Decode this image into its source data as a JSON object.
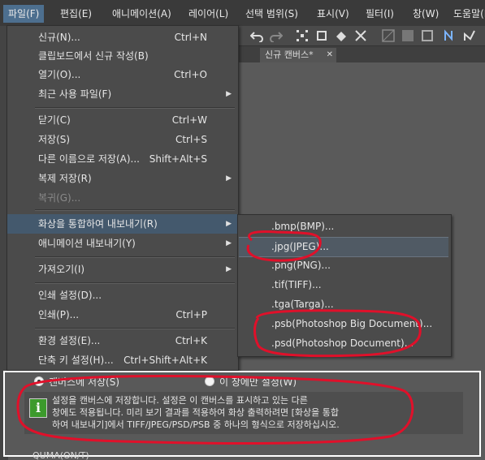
{
  "menubar": {
    "items": [
      {
        "label": "파일(F)"
      },
      {
        "label": "편집(E)"
      },
      {
        "label": "애니메이션(A)"
      },
      {
        "label": "레이어(L)"
      },
      {
        "label": "선택 범위(S)"
      },
      {
        "label": "표시(V)"
      },
      {
        "label": "필터(I)"
      },
      {
        "label": "창(W)"
      },
      {
        "label": "도움말(H)"
      }
    ]
  },
  "document_tab": {
    "label": "신규 캔버스*",
    "close": "✕"
  },
  "file_menu": {
    "items": [
      {
        "label": "신규(N)...",
        "shortcut": "Ctrl+N"
      },
      {
        "label": "클립보드에서 신규 작성(B)",
        "shortcut": ""
      },
      {
        "label": "열기(O)...",
        "shortcut": "Ctrl+O"
      },
      {
        "label": "최근 사용 파일(F)",
        "shortcut": "",
        "arrow": "▶"
      },
      {
        "label": "닫기(C)",
        "shortcut": "Ctrl+W"
      },
      {
        "label": "저장(S)",
        "shortcut": "Ctrl+S"
      },
      {
        "label": "다른 이름으로 저장(A)...",
        "shortcut": "Shift+Alt+S"
      },
      {
        "label": "복제 저장(R)",
        "shortcut": "",
        "arrow": "▶"
      },
      {
        "label": "복귀(G)...",
        "shortcut": "",
        "disabled": true
      },
      {
        "label": "화상을 통합하여 내보내기(R)",
        "shortcut": "",
        "arrow": "▶",
        "highlighted": true
      },
      {
        "label": "애니메이션 내보내기(Y)",
        "shortcut": "",
        "arrow": "▶"
      },
      {
        "label": "가져오기(I)",
        "shortcut": "",
        "arrow": "▶"
      },
      {
        "label": "인쇄 설정(D)...",
        "shortcut": ""
      },
      {
        "label": "인쇄(P)...",
        "shortcut": "Ctrl+P"
      },
      {
        "label": "환경 설정(E)...",
        "shortcut": "Ctrl+K"
      },
      {
        "label": "단축 키 설정(H)...",
        "shortcut": "Ctrl+Shift+Alt+K"
      }
    ]
  },
  "export_submenu": {
    "items": [
      {
        "label": ".bmp(BMP)..."
      },
      {
        "label": ".jpg(JPEG)...",
        "highlighted": true
      },
      {
        "label": ".png(PNG)..."
      },
      {
        "label": ".tif(TIFF)..."
      },
      {
        "label": ".tga(Targa)..."
      },
      {
        "label": ".psb(Photoshop Big Document)..."
      },
      {
        "label": ".psd(Photoshop Document)..."
      }
    ]
  },
  "dialog": {
    "radio_canvas": "캔버스에 저장(S)",
    "radio_window": "이 창에만 설정(W)",
    "info_line1": "설정을 캔버스에 저장합니다. 설정은 이 캔버스를 표시하고 있는 다른",
    "info_line2": "창에도 적용됩니다. 미리 보기 결과를 적용하여 화상 출력하려면 [화상을 통합",
    "info_line3": "하여 내보내기]에서 TIFF/JPEG/PSD/PSB 중 하나의 형식으로 저장하십시오.",
    "cut_text": "QUMA(ON/T)"
  },
  "colors": {
    "menu_bg": "#4b4b4b",
    "highlight": "#44596d",
    "annotation": "#e0102a",
    "info_icon": "#3c9a2c"
  },
  "icons": [
    "undo-icon",
    "redo-icon",
    "transform-icon",
    "crop-icon",
    "fill-icon",
    "move-icon",
    "grid-icon",
    "ruler-icon"
  ]
}
